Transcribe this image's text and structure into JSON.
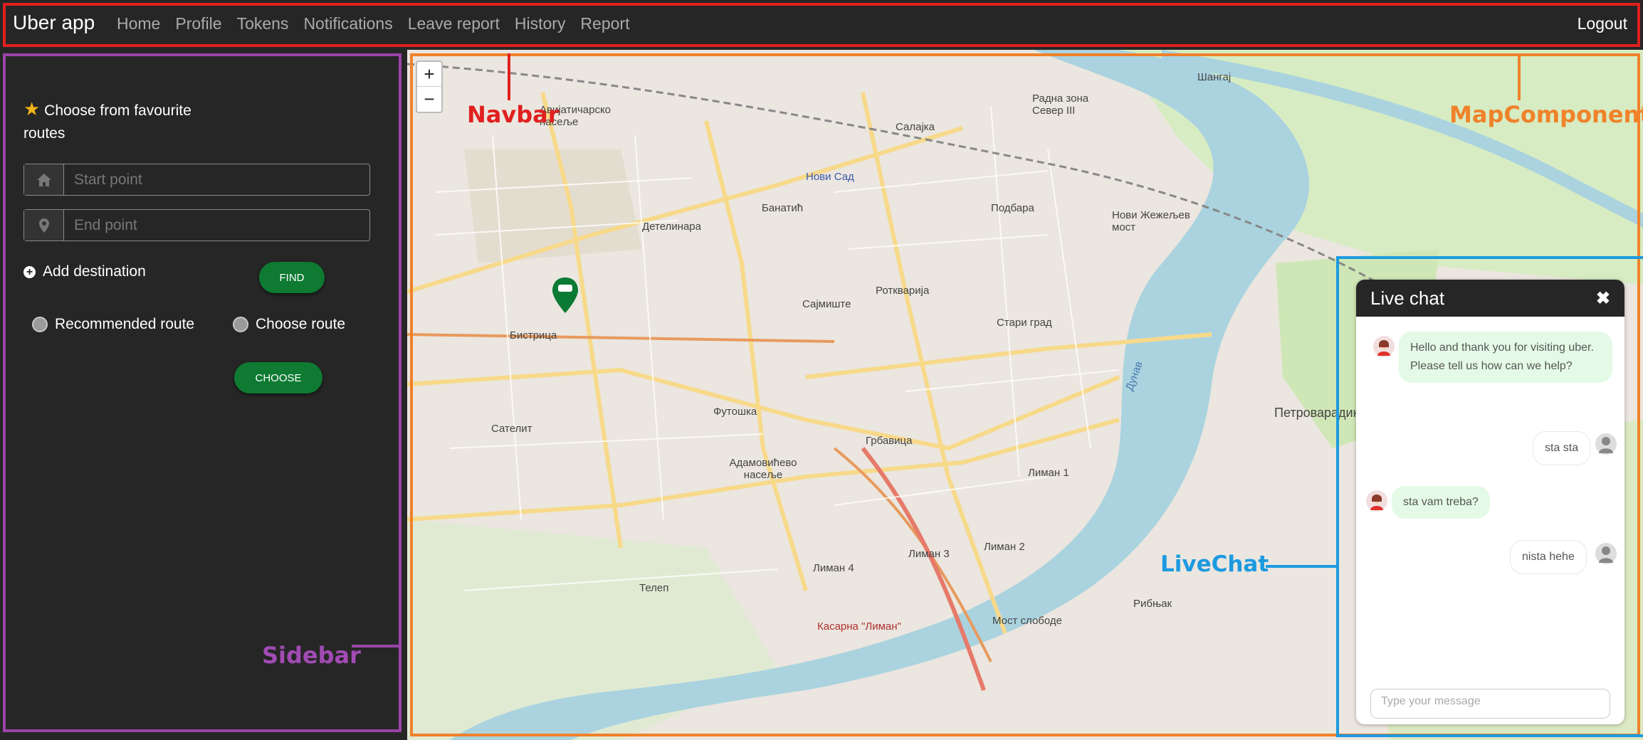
{
  "navbar": {
    "brand": "Uber app",
    "links": [
      "Home",
      "Profile",
      "Tokens",
      "Notifications",
      "Leave report",
      "History",
      "Report"
    ],
    "logout": "Logout",
    "annotation": "Navbar"
  },
  "sidebar": {
    "favourite_label": "Choose from favourite routes",
    "start_placeholder": "Start point",
    "end_placeholder": "End point",
    "add_destination": "Add destination",
    "find_button": "FIND",
    "radio_recommended": "Recommended route",
    "radio_choose": "Choose route",
    "choose_button": "CHOOSE",
    "annotation": "Sidebar"
  },
  "map": {
    "zoom_in": "+",
    "zoom_out": "−",
    "annotation": "MapComponent",
    "places": [
      {
        "name": "Нови Сад"
      },
      {
        "name": "Банатић"
      },
      {
        "name": "Детелинара"
      },
      {
        "name": "Сајмиште"
      },
      {
        "name": "Ротквариjа"
      },
      {
        "name": "Стари град"
      },
      {
        "name": "Бистрица"
      },
      {
        "name": "Сателит"
      },
      {
        "name": "Грбавица"
      },
      {
        "name": "Адамовићево насеље"
      },
      {
        "name": "Лиман 1"
      },
      {
        "name": "Лиман 2"
      },
      {
        "name": "Лиман 3"
      },
      {
        "name": "Лиман 4"
      },
      {
        "name": "Телеп"
      },
      {
        "name": "Мост слободе"
      },
      {
        "name": "Петроварадин"
      },
      {
        "name": "Рибњак"
      },
      {
        "name": "Подбара"
      },
      {
        "name": "Салајка"
      },
      {
        "name": "Шангај"
      },
      {
        "name": "Нови Жежељев мост"
      },
      {
        "name": "Радна зона Север III"
      },
      {
        "name": "Касарна \"Лиман\""
      },
      {
        "name": "Авијатичарско насеље"
      },
      {
        "name": "Футошка"
      },
      {
        "name": "Дунав"
      }
    ]
  },
  "chat": {
    "title": "Live chat",
    "close": "✖",
    "annotation": "LiveChat",
    "messages": [
      {
        "from": "support",
        "text": "Hello and thank you for visiting uber. Please tell us how can we help?"
      },
      {
        "from": "user",
        "text": "sta sta"
      },
      {
        "from": "support",
        "text": "sta vam treba?"
      },
      {
        "from": "user",
        "text": "nista hehe"
      }
    ],
    "input_placeholder": "Type your message"
  },
  "colors": {
    "navbar_outline": "#e0201f",
    "sidebar_outline": "#9b44a9",
    "map_outline": "#f0822a",
    "chat_outline": "#1d9ae0",
    "button_green": "#0e7a32"
  }
}
